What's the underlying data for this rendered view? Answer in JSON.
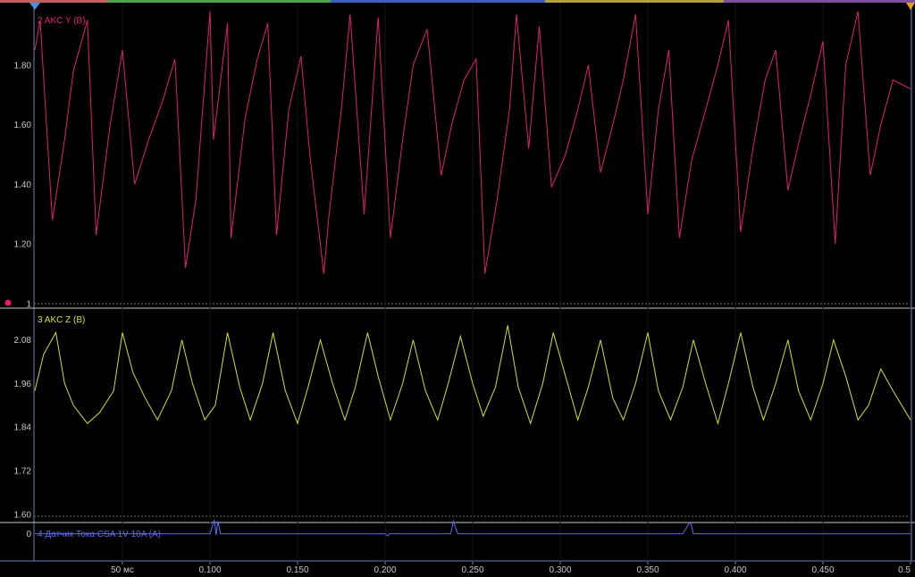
{
  "colors": {
    "background": "#000000",
    "channel_y": "#e0206e",
    "channel_z": "#d8e024",
    "channel_current": "#5a6cf0",
    "grid": "#1a1a1a",
    "axis": "#6a82b8",
    "cursor_left": "#4a90e0",
    "cursor_right": "#e0a020"
  },
  "icons": {
    "left_cursor": "triangle-down-blue",
    "right_cursor": "triangle-down-orange",
    "channel_marker": "dot-pink"
  },
  "chart_data": [
    {
      "type": "line",
      "title": "2 AKC Y (B)",
      "x_range": [
        0.0,
        0.5
      ],
      "x_unit": "s",
      "ylim": [
        1.0,
        2.0
      ],
      "yticks": [
        "1.80",
        "1.60",
        "1.40",
        "1.20",
        "1"
      ],
      "ytick_values": [
        1.8,
        1.6,
        1.4,
        1.2,
        1.0
      ],
      "series": [
        {
          "x": [
            0.0,
            0.003,
            0.01,
            0.017,
            0.022,
            0.03,
            0.035,
            0.043,
            0.05,
            0.057,
            0.065,
            0.073,
            0.08,
            0.086,
            0.092,
            0.1,
            0.102,
            0.11,
            0.112,
            0.12,
            0.127,
            0.133,
            0.138,
            0.145,
            0.152,
            0.157,
            0.165,
            0.168,
            0.175,
            0.18,
            0.188,
            0.196,
            0.203,
            0.21,
            0.216,
            0.224,
            0.232,
            0.238,
            0.245,
            0.252,
            0.257,
            0.264,
            0.271,
            0.275,
            0.282,
            0.288,
            0.295,
            0.303,
            0.31,
            0.316,
            0.323,
            0.33,
            0.336,
            0.343,
            0.35,
            0.356,
            0.362,
            0.368,
            0.375,
            0.383,
            0.39,
            0.396,
            0.403,
            0.41,
            0.417,
            0.423,
            0.43,
            0.437,
            0.443,
            0.45,
            0.457,
            0.463,
            0.47,
            0.477,
            0.483,
            0.49,
            0.5
          ],
          "values": [
            1.85,
            1.95,
            1.28,
            1.55,
            1.78,
            1.95,
            1.23,
            1.6,
            1.85,
            1.4,
            1.55,
            1.68,
            1.82,
            1.12,
            1.35,
            1.98,
            1.55,
            1.94,
            1.22,
            1.62,
            1.82,
            1.94,
            1.23,
            1.65,
            1.83,
            1.5,
            1.1,
            1.3,
            1.65,
            1.97,
            1.3,
            1.96,
            1.22,
            1.55,
            1.8,
            1.92,
            1.43,
            1.6,
            1.75,
            1.82,
            1.1,
            1.35,
            1.65,
            1.97,
            1.52,
            1.93,
            1.39,
            1.5,
            1.65,
            1.8,
            1.44,
            1.6,
            1.75,
            1.97,
            1.3,
            1.65,
            1.85,
            1.22,
            1.48,
            1.65,
            1.8,
            1.95,
            1.24,
            1.52,
            1.75,
            1.85,
            1.38,
            1.56,
            1.7,
            1.88,
            1.2,
            1.8,
            1.98,
            1.43,
            1.6,
            1.75,
            1.72
          ]
        }
      ]
    },
    {
      "type": "line",
      "title": "3 AKC Z (B)",
      "x_range": [
        0.0,
        0.5
      ],
      "x_unit": "s",
      "ylim": [
        1.58,
        2.16
      ],
      "yticks": [
        "2.08",
        "1.96",
        "1.84",
        "1.72",
        "1.60"
      ],
      "ytick_values": [
        2.08,
        1.96,
        1.84,
        1.72,
        1.6
      ],
      "series": [
        {
          "x": [
            0.0,
            0.005,
            0.012,
            0.017,
            0.022,
            0.03,
            0.037,
            0.045,
            0.05,
            0.056,
            0.063,
            0.07,
            0.078,
            0.084,
            0.09,
            0.097,
            0.103,
            0.11,
            0.117,
            0.123,
            0.13,
            0.136,
            0.143,
            0.15,
            0.156,
            0.163,
            0.17,
            0.177,
            0.183,
            0.19,
            0.196,
            0.203,
            0.21,
            0.216,
            0.223,
            0.23,
            0.236,
            0.243,
            0.25,
            0.256,
            0.263,
            0.27,
            0.276,
            0.283,
            0.29,
            0.296,
            0.303,
            0.31,
            0.316,
            0.323,
            0.33,
            0.336,
            0.343,
            0.35,
            0.356,
            0.363,
            0.37,
            0.376,
            0.383,
            0.39,
            0.396,
            0.403,
            0.41,
            0.416,
            0.423,
            0.43,
            0.436,
            0.443,
            0.45,
            0.456,
            0.463,
            0.47,
            0.476,
            0.483,
            0.49,
            0.5
          ],
          "values": [
            1.94,
            2.04,
            2.1,
            1.96,
            1.9,
            1.85,
            1.88,
            1.94,
            2.1,
            1.99,
            1.92,
            1.86,
            1.94,
            2.08,
            1.96,
            1.86,
            1.9,
            2.1,
            1.95,
            1.86,
            1.96,
            2.1,
            1.94,
            1.85,
            1.95,
            2.08,
            1.96,
            1.86,
            1.95,
            2.1,
            1.98,
            1.86,
            1.96,
            2.08,
            1.94,
            1.86,
            1.96,
            2.09,
            1.96,
            1.87,
            1.95,
            2.12,
            1.95,
            1.85,
            1.96,
            2.1,
            1.98,
            1.86,
            1.95,
            2.08,
            1.92,
            1.86,
            1.96,
            2.1,
            1.94,
            1.86,
            1.95,
            2.08,
            1.96,
            1.85,
            1.96,
            2.1,
            1.95,
            1.86,
            1.96,
            2.08,
            1.94,
            1.86,
            1.96,
            2.08,
            1.98,
            1.86,
            1.9,
            2.0,
            1.94,
            1.86
          ]
        }
      ]
    },
    {
      "type": "line",
      "title": "4 Датчик Тока CSA 1V 10A (A)",
      "x_range": [
        0.0,
        0.5
      ],
      "x_unit": "s",
      "ylim": [
        -0.5,
        2.0
      ],
      "yticks": [
        "0"
      ],
      "ytick_values": [
        0
      ],
      "series": [
        {
          "x": [
            0.0,
            0.1,
            0.1025,
            0.1035,
            0.1045,
            0.106,
            0.2,
            0.2015,
            0.2025,
            0.205,
            0.2375,
            0.239,
            0.24,
            0.2415,
            0.37,
            0.3735,
            0.3745,
            0.376,
            0.5
          ],
          "values": [
            0.0,
            0.0,
            1.2,
            -0.1,
            1.1,
            0.0,
            0.0,
            -0.2,
            0.0,
            0.0,
            0.0,
            1.1,
            0.6,
            0.0,
            0.0,
            0.9,
            0.95,
            0.0,
            0.0
          ]
        }
      ]
    }
  ],
  "x_axis": {
    "ticks": [
      {
        "t": 0.05,
        "label": "50 мс"
      },
      {
        "t": 0.1,
        "label": "0.100"
      },
      {
        "t": 0.15,
        "label": "0.150"
      },
      {
        "t": 0.2,
        "label": "0.200"
      },
      {
        "t": 0.25,
        "label": "0.250"
      },
      {
        "t": 0.3,
        "label": "0.300"
      },
      {
        "t": 0.35,
        "label": "0.350"
      },
      {
        "t": 0.4,
        "label": "0.400"
      },
      {
        "t": 0.45,
        "label": "0.450"
      },
      {
        "t": 0.5,
        "label": "0.5"
      }
    ]
  }
}
